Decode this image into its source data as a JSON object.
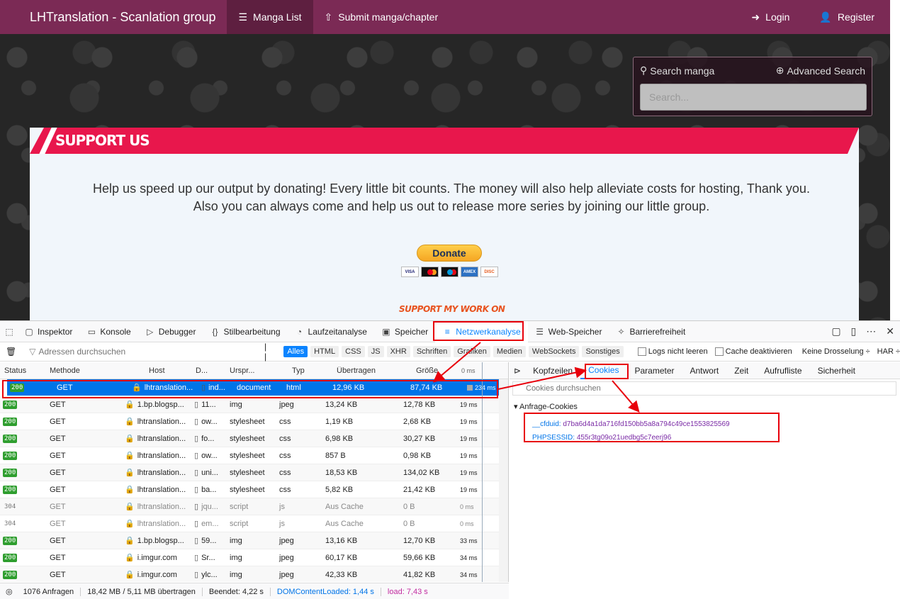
{
  "site": {
    "brand": "LHTranslation - Scanlation group",
    "nav": [
      {
        "label": "Manga List",
        "icon": "list-icon"
      },
      {
        "label": "Submit manga/chapter",
        "icon": "upload-icon"
      }
    ],
    "nav_right": [
      {
        "label": "Login",
        "icon": "login-icon"
      },
      {
        "label": "Register",
        "icon": "user-icon"
      }
    ],
    "search": {
      "label": "Search manga",
      "advanced": "Advanced Search",
      "placeholder": "Search..."
    },
    "support": {
      "title": "SUPPORT US",
      "line1": "Help us speed up our output by donating! Every little bit counts. The money will also help alleviate costs for hosting, Thank you.",
      "line2": "Also you can always come and help us out to release more series by joining our little group.",
      "donate": "Donate",
      "work": "SUPPORT MY WORK ON"
    }
  },
  "devtools": {
    "tabs": [
      "Inspektor",
      "Konsole",
      "Debugger",
      "Stilbearbeitung",
      "Laufzeitanalyse",
      "Speicher",
      "Netzwerkanalyse",
      "Web-Speicher",
      "Barrierefreiheit"
    ],
    "active_tab": "Netzwerkanalyse",
    "filter_placeholder": "Adressen durchsuchen",
    "pause": "| |",
    "type_filters": [
      "Alles",
      "HTML",
      "CSS",
      "JS",
      "XHR",
      "Schriften",
      "Grafiken",
      "Medien",
      "WebSockets",
      "Sonstiges"
    ],
    "options": [
      "Logs nicht leeren",
      "Cache deaktivieren"
    ],
    "throttle": "Keine Drosselung ÷",
    "har": "HAR ÷",
    "columns": [
      "Status",
      "Methode",
      "Host",
      "D...",
      "Urspr...",
      "Typ",
      "Übertragen",
      "Größe",
      "0 ms"
    ],
    "rows": [
      {
        "status": "200",
        "method": "GET",
        "host": "lhtranslation...",
        "file": "ind...",
        "cause": "document",
        "type": "html",
        "transferred": "12,96 KB",
        "size": "87,74 KB",
        "time": "234 ms"
      },
      {
        "status": "200",
        "method": "GET",
        "host": "1.bp.blogsp...",
        "file": "11...",
        "cause": "img",
        "type": "jpeg",
        "transferred": "13,24 KB",
        "size": "12,78 KB",
        "time": "19 ms"
      },
      {
        "status": "200",
        "method": "GET",
        "host": "lhtranslation...",
        "file": "ow...",
        "cause": "stylesheet",
        "type": "css",
        "transferred": "1,19 KB",
        "size": "2,68 KB",
        "time": "19 ms"
      },
      {
        "status": "200",
        "method": "GET",
        "host": "lhtranslation...",
        "file": "fo...",
        "cause": "stylesheet",
        "type": "css",
        "transferred": "6,98 KB",
        "size": "30,27 KB",
        "time": "19 ms"
      },
      {
        "status": "200",
        "method": "GET",
        "host": "lhtranslation...",
        "file": "ow...",
        "cause": "stylesheet",
        "type": "css",
        "transferred": "857 B",
        "size": "0,98 KB",
        "time": "19 ms"
      },
      {
        "status": "200",
        "method": "GET",
        "host": "lhtranslation...",
        "file": "uni...",
        "cause": "stylesheet",
        "type": "css",
        "transferred": "18,53 KB",
        "size": "134,02 KB",
        "time": "19 ms"
      },
      {
        "status": "200",
        "method": "GET",
        "host": "lhtranslation...",
        "file": "ba...",
        "cause": "stylesheet",
        "type": "css",
        "transferred": "5,82 KB",
        "size": "21,42 KB",
        "time": "19 ms"
      },
      {
        "status": "304",
        "method": "GET",
        "host": "lhtranslation...",
        "file": "jqu...",
        "cause": "script",
        "type": "js",
        "transferred": "Aus Cache",
        "size": "0 B",
        "time": "0 ms"
      },
      {
        "status": "304",
        "method": "GET",
        "host": "lhtranslation...",
        "file": "em...",
        "cause": "script",
        "type": "js",
        "transferred": "Aus Cache",
        "size": "0 B",
        "time": "0 ms"
      },
      {
        "status": "200",
        "method": "GET",
        "host": "1.bp.blogsp...",
        "file": "59...",
        "cause": "img",
        "type": "jpeg",
        "transferred": "13,16 KB",
        "size": "12,70 KB",
        "time": "33 ms"
      },
      {
        "status": "200",
        "method": "GET",
        "host": "i.imgur.com",
        "file": "Sr...",
        "cause": "img",
        "type": "jpeg",
        "transferred": "60,17 KB",
        "size": "59,66 KB",
        "time": "34 ms"
      },
      {
        "status": "200",
        "method": "GET",
        "host": "i.imgur.com",
        "file": "ylc...",
        "cause": "img",
        "type": "jpeg",
        "transferred": "42,33 KB",
        "size": "41,82 KB",
        "time": "34 ms"
      }
    ],
    "side_tabs": [
      "Kopfzeilen",
      "Cookies",
      "Parameter",
      "Antwort",
      "Zeit",
      "Aufrufliste",
      "Sicherheit"
    ],
    "active_side_tab": "Cookies",
    "cookie_filter": "Cookies durchsuchen",
    "cookie_section": "Anfrage-Cookies",
    "cookies": [
      {
        "name": "__cfduid:",
        "value": "d7ba6d4a1da716fd150bb5a8a794c49ce1553825569"
      },
      {
        "name": "PHPSESSID:",
        "value": "455r3tg09o21uedbg5c7eerj96"
      }
    ],
    "status_bar": {
      "requests": "1076 Anfragen",
      "transferred": "18,42 MB / 5,11 MB übertragen",
      "finished": "Beendet: 4,22 s",
      "dcl": "DOMContentLoaded: 1,44 s",
      "load": "load: 7,43 s"
    }
  }
}
